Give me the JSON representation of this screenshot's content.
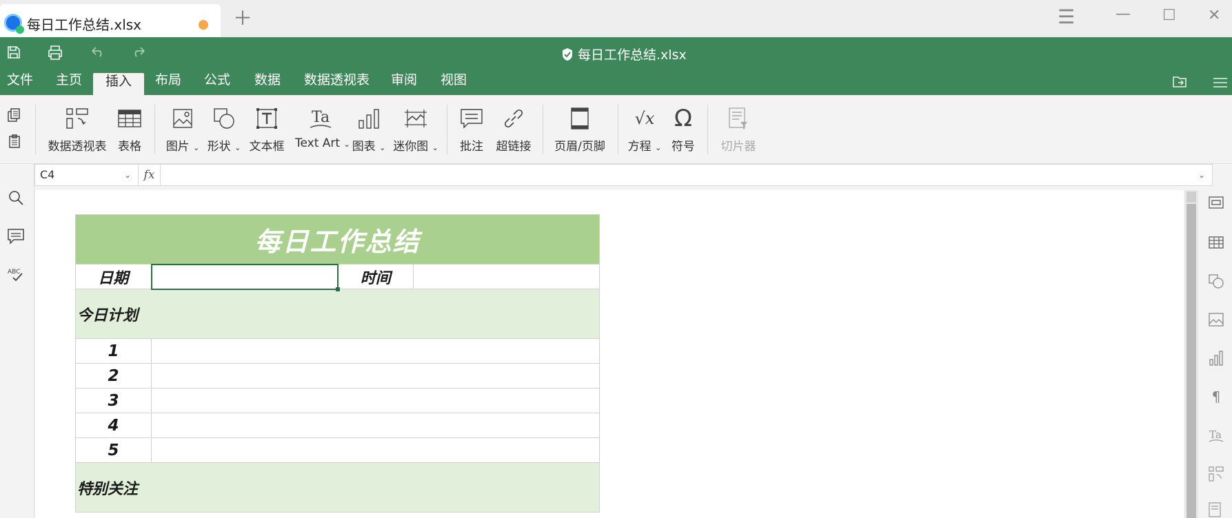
{
  "tab": {
    "title": "每日工作总结.xlsx"
  },
  "titlebar": {
    "file_title": "每日工作总结.xlsx"
  },
  "menu": [
    "文件",
    "主页",
    "插入",
    "布局",
    "公式",
    "数据",
    "数据透视表",
    "审阅",
    "视图"
  ],
  "menu_active": "插入",
  "ribbon": {
    "pivot": "数据透视表",
    "table": "表格",
    "picture": "图片",
    "shape": "形状",
    "textbox": "文本框",
    "textart": "Text Art",
    "chart": "图表",
    "sparkline": "迷你图",
    "comment": "批注",
    "hyperlink": "超链接",
    "header_footer": "页眉/页脚",
    "equation": "方程",
    "symbol": "符号",
    "slicer": "切片器"
  },
  "formula_bar": {
    "cell_ref": "C4",
    "fx_label": "fx",
    "formula": ""
  },
  "sheet": {
    "title": "每日工作总结",
    "date_label": "日期",
    "date_value": "",
    "time_label": "时间",
    "time_value": "",
    "section_plan": "今日计划",
    "plan_rows": [
      "1",
      "2",
      "3",
      "4",
      "5"
    ],
    "section_focus": "特别关注"
  },
  "colors": {
    "brand_green": "#3e875a",
    "title_fill": "#a9d08e",
    "section_fill": "#e2efda",
    "unsaved_dot": "#f5a74a"
  },
  "icons": [
    "save-icon",
    "print-icon",
    "undo-icon",
    "redo-icon",
    "shield-icon",
    "search-icon",
    "comment-icon",
    "spellcheck-icon"
  ]
}
